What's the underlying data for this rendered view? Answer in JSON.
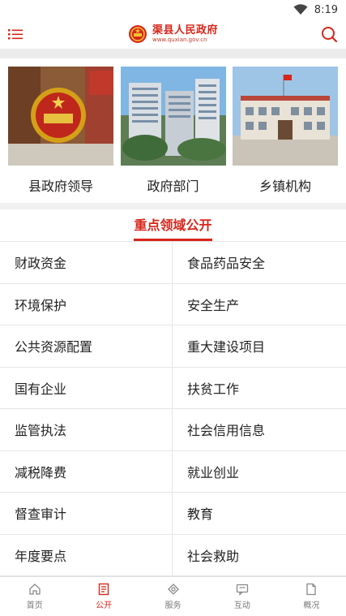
{
  "status": {
    "time": "8:19"
  },
  "header": {
    "title": "渠县人民政府",
    "url": "www.quxian.gov.cn"
  },
  "cards": [
    {
      "label": "县政府领导",
      "icon": "emblem-photo"
    },
    {
      "label": "政府部门",
      "icon": "building-photo"
    },
    {
      "label": "乡镇机构",
      "icon": "township-photo"
    }
  ],
  "section": {
    "title": "重点领域公开"
  },
  "grid": [
    [
      "财政资金",
      "食品药品安全"
    ],
    [
      "环境保护",
      "安全生产"
    ],
    [
      "公共资源配置",
      "重大建设项目"
    ],
    [
      "国有企业",
      "扶贫工作"
    ],
    [
      "监管执法",
      "社会信用信息"
    ],
    [
      "减税降费",
      "就业创业"
    ],
    [
      "督查审计",
      "教育"
    ],
    [
      "年度要点",
      "社会救助"
    ]
  ],
  "tabs": [
    {
      "label": "首页",
      "icon": "home-icon",
      "active": false
    },
    {
      "label": "公开",
      "icon": "document-icon",
      "active": true
    },
    {
      "label": "服务",
      "icon": "service-icon",
      "active": false
    },
    {
      "label": "互动",
      "icon": "chat-icon",
      "active": false
    },
    {
      "label": "概况",
      "icon": "overview-icon",
      "active": false
    }
  ],
  "colors": {
    "accent": "#d7261b",
    "divider": "#e6e6e6",
    "band": "#ececec"
  }
}
